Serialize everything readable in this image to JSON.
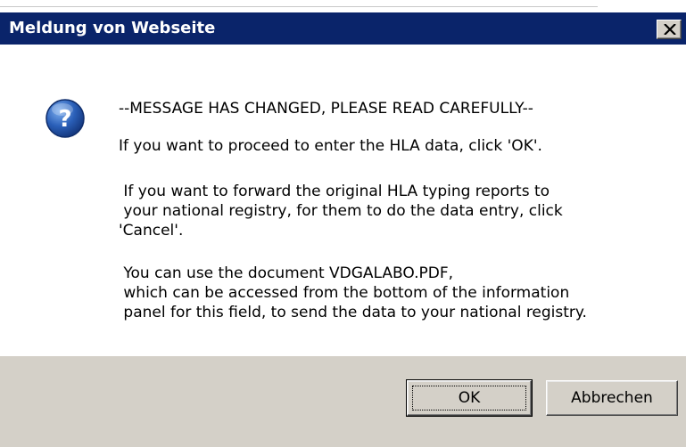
{
  "dialog": {
    "title": "Meldung von Webseite",
    "icon": "question-icon",
    "message": {
      "line1": "--MESSAGE HAS CHANGED, PLEASE READ CAREFULLY--",
      "line2": "If you want to proceed to enter the HLA data, click 'OK'.",
      "line3": " If you want to forward the original HLA typing reports to",
      "line4": " your national registry, for them to do the data entry, click",
      "line5": "'Cancel'.",
      "line6": " You can use the document VDGALABO.PDF,",
      "line7": " which can be accessed from the bottom of the information",
      "line8": " panel for this field, to send the data to your national registry."
    },
    "buttons": {
      "ok_label": "OK",
      "cancel_label": "Abbrechen"
    },
    "colors": {
      "titlebar": "#0a246a",
      "button_face": "#d4d0c8",
      "question_icon": "#2a5fb8"
    }
  }
}
